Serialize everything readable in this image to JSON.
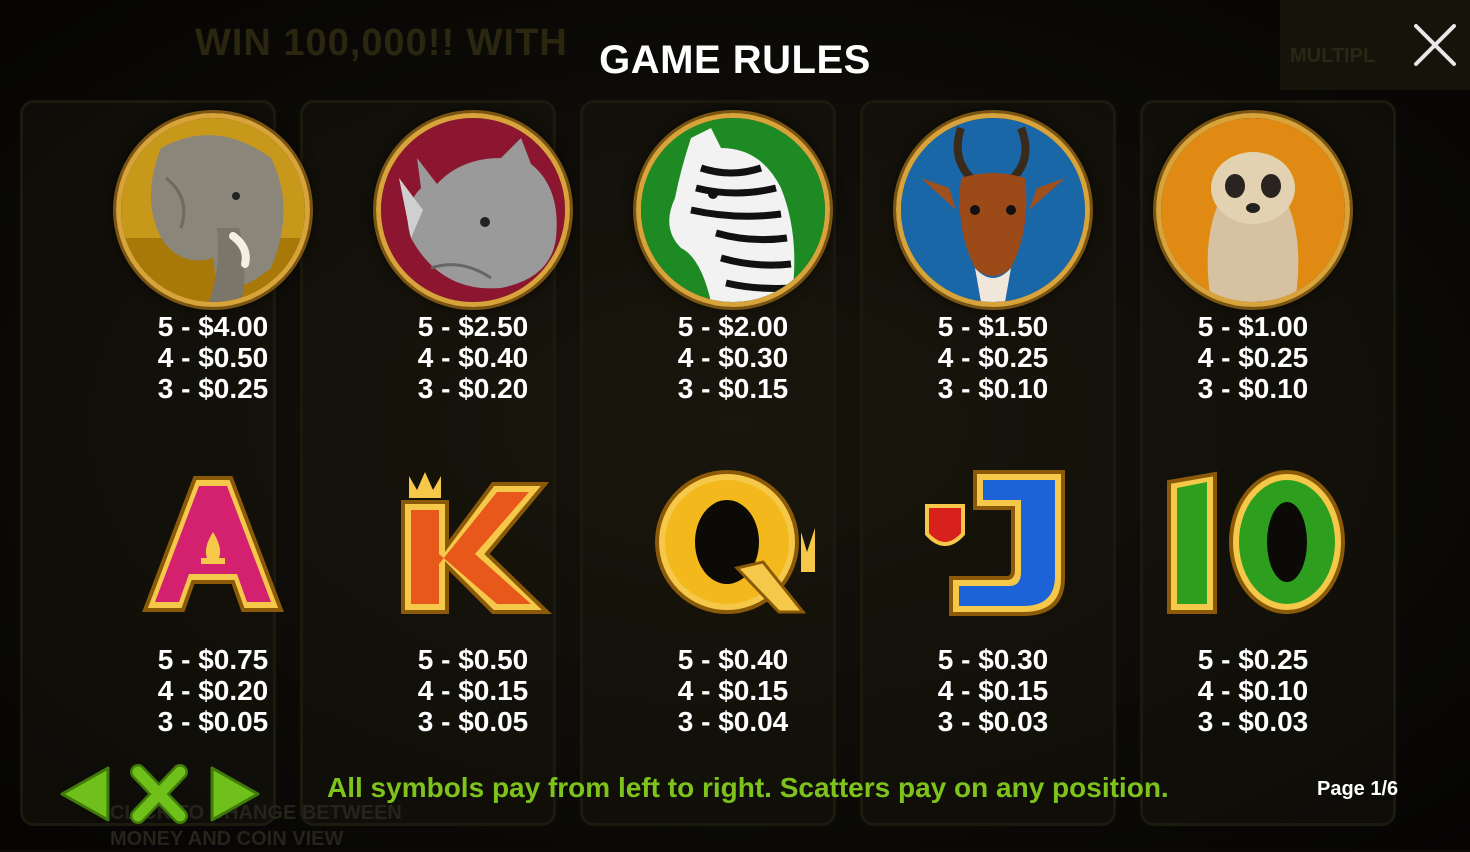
{
  "header": {
    "title": "GAME RULES",
    "close_icon": "close-icon"
  },
  "background": {
    "banner_text": "WIN 100,000!! WITH",
    "corner_text": "MULTIPL",
    "bottom_text_1": "CLICK TO CHANGE BETWEEN",
    "bottom_text_2": "MONEY AND COIN VIEW"
  },
  "symbols": [
    {
      "name": "elephant",
      "bg": "#c8981a",
      "pays": [
        "5 - $4.00",
        "4 - $0.50",
        "3 - $0.25"
      ]
    },
    {
      "name": "rhino",
      "bg": "#8c1630",
      "pays": [
        "5 - $2.50",
        "4 - $0.40",
        "3 - $0.20"
      ]
    },
    {
      "name": "zebra",
      "bg": "#1e8a24",
      "pays": [
        "5 - $2.00",
        "4 - $0.30",
        "3 - $0.15"
      ]
    },
    {
      "name": "antelope",
      "bg": "#1a67a8",
      "pays": [
        "5 - $1.50",
        "4 - $0.25",
        "3 - $0.10"
      ]
    },
    {
      "name": "meerkat",
      "bg": "#e08a14",
      "pays": [
        "5 - $1.00",
        "4 - $0.25",
        "3 - $0.10"
      ]
    },
    {
      "name": "A",
      "color": "#d3206f",
      "pays": [
        "5 - $0.75",
        "4 - $0.20",
        "3 - $0.05"
      ]
    },
    {
      "name": "K",
      "color": "#e8581a",
      "pays": [
        "5 - $0.50",
        "4 - $0.15",
        "3 - $0.05"
      ]
    },
    {
      "name": "Q",
      "color": "#f2b81c",
      "pays": [
        "5 - $0.40",
        "4 - $0.15",
        "3 - $0.04"
      ]
    },
    {
      "name": "J",
      "color": "#1c63d8",
      "pays": [
        "5 - $0.30",
        "4 - $0.15",
        "3 - $0.03"
      ]
    },
    {
      "name": "10",
      "color": "#2e9e1e",
      "pays": [
        "5 - $0.25",
        "4 - $0.10",
        "3 - $0.03"
      ]
    }
  ],
  "footer": {
    "prev_icon": "arrow-left-icon",
    "close_icon": "close-x-icon",
    "next_icon": "arrow-right-icon",
    "text": "All symbols pay from left to right. Scatters pay on any position.",
    "page": "Page 1/6"
  },
  "colors": {
    "accent_green": "#7ec31c",
    "gold": "#d7a33a"
  }
}
